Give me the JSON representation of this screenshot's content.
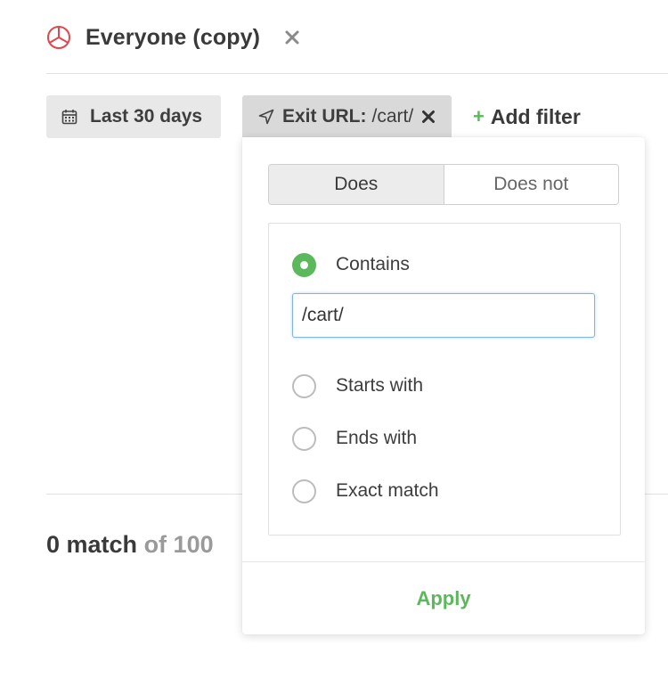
{
  "header": {
    "segment_icon": "pie-chart-icon",
    "title": "Everyone (copy)",
    "close_icon": "close-icon"
  },
  "filters": {
    "date_chip": {
      "icon": "calendar-icon",
      "label": "Last 30 days"
    },
    "exit_chip": {
      "icon": "navigation-arrow-icon",
      "key": "Exit URL:",
      "value": "/cart/",
      "remove_icon": "close-icon"
    },
    "add_filter": {
      "plus": "+",
      "label": "Add filter"
    }
  },
  "popover": {
    "toggle": {
      "options": [
        "Does",
        "Does not"
      ],
      "selected": "Does"
    },
    "match_options": [
      {
        "label": "Contains",
        "checked": true
      },
      {
        "label": "Starts with",
        "checked": false
      },
      {
        "label": "Ends with",
        "checked": false
      },
      {
        "label": "Exact match",
        "checked": false
      }
    ],
    "input_value": "/cart/",
    "apply_label": "Apply"
  },
  "results": {
    "count_text": "0 match",
    "total_text": "of 100"
  },
  "colors": {
    "accent_green": "#5cb85c",
    "segment_icon_red": "#e0474c",
    "input_focus_blue": "#7fb4e6"
  }
}
